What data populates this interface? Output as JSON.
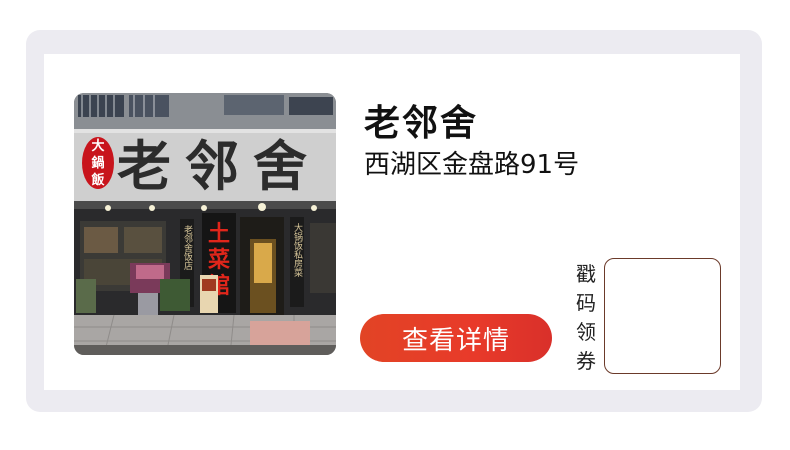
{
  "card": {
    "shop_name": "老邻舍",
    "address": "西湖区金盘路91号",
    "detail_button_label": "查看详情",
    "stamp_label_chars": [
      "戳",
      "码",
      "领",
      "券"
    ]
  },
  "photo": {
    "sign_text": "老邻舍",
    "badge_chars": [
      "大",
      "鍋",
      "飯"
    ],
    "red_sign_chars": [
      "土",
      "菜",
      "馆"
    ],
    "vertical_banner_left": "老邻舍饭店",
    "vertical_banner_right": "大锅饭私房菜"
  },
  "colors": {
    "frame_bg": "#ecebf1",
    "button_red": "#e83a2a",
    "stamp_border": "#6b3a2a"
  }
}
